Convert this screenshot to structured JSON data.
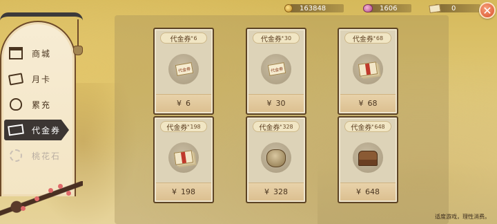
{
  "currencies": [
    {
      "icon": "coin-icon",
      "value": "163848"
    },
    {
      "icon": "gem-icon",
      "value": "1606"
    },
    {
      "icon": "voucher-icon",
      "value": "0"
    }
  ],
  "close_label": "✕",
  "nav": {
    "items": [
      {
        "label": "商城",
        "icon": "shop-icon",
        "active": false,
        "disabled": false
      },
      {
        "label": "月卡",
        "icon": "month-card-icon",
        "active": false,
        "disabled": false
      },
      {
        "label": "累充",
        "icon": "money-bag-icon",
        "active": false,
        "disabled": false
      },
      {
        "label": "代金券",
        "icon": "voucher-icon",
        "active": true,
        "disabled": false
      },
      {
        "label": "桃花石",
        "icon": "peach-blossom-stone-icon",
        "active": false,
        "disabled": true
      }
    ]
  },
  "cards": [
    {
      "name": "代金券",
      "star": "*",
      "qty": "6",
      "currency": "¥",
      "price": "6",
      "art": "ticket-single-icon",
      "art_text": "代金券"
    },
    {
      "name": "代金券",
      "star": "*",
      "qty": "30",
      "currency": "¥",
      "price": "30",
      "art": "ticket-single-icon",
      "art_text": "代金券"
    },
    {
      "name": "代金券",
      "star": "*",
      "qty": "68",
      "currency": "¥",
      "price": "68",
      "art": "ticket-stack-icon"
    },
    {
      "name": "代金券",
      "star": "*",
      "qty": "198",
      "currency": "¥",
      "price": "198",
      "art": "ticket-stack-icon"
    },
    {
      "name": "代金券",
      "star": "*",
      "qty": "328",
      "currency": "¥",
      "price": "328",
      "art": "money-pouch-icon"
    },
    {
      "name": "代金券",
      "star": "*",
      "qty": "648",
      "currency": "¥",
      "price": "648",
      "art": "treasure-chest-icon"
    }
  ],
  "footer_note": "适度游戏，理性消费。"
}
